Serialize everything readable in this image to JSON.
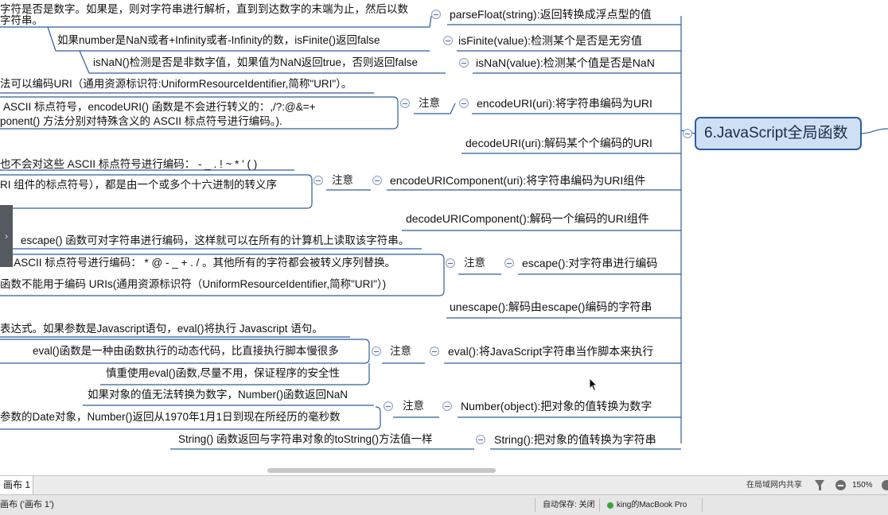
{
  "mindmap": {
    "center_topic": "6.JavaScript全局函数",
    "nodes": [
      {
        "label": "parseFloat(string):返回转换成浮点型的值",
        "notes": [
          "字符是否是数字。如果是，则对字符串进行解析，直到到达数字的末端为止，然后以数",
          "字符串。"
        ]
      },
      {
        "label": "isFinite(value):检测某个是否是无穷值",
        "notes": [
          "如果number是NaN或者+Infinity或者-Infinity的数，isFinite()返回false"
        ]
      },
      {
        "label": "isNaN(value):检测某个值是否是NaN",
        "notes": [
          "isNaN()检测是否是非数字值，如果值为NaN返回true，否则返回false"
        ]
      },
      {
        "label": "encodeURI(uri):将字符串编码为URI",
        "tag": "注意",
        "notes": [
          "法可以编码URI（通用资源标识符:UniformResourceIdentifier,简称\"URI\"）。",
          "ASCII 标点符号，encodeURI() 函数是不会进行转义的：,/?:@&=+",
          "ponent() 方法分别对特殊含义的 ASCII 标点符号进行编码。)."
        ]
      },
      {
        "label": "decodeURI(uri):解码某个个编码的URI",
        "notes": []
      },
      {
        "label": "encodeURIComponent(uri):将字符串编码为URI组件",
        "tag": "注意",
        "notes": [
          "也不会对这些 ASCII 标点符号进行编码： - _ . ! ~ * ' ( )",
          "RI 组件的标点符号），都是由一个或多个十六进制的转义序"
        ]
      },
      {
        "label": "decodeURIComponent():解码一个编码的URI组件",
        "notes": []
      },
      {
        "label": "escape():对字符串进行编码",
        "tag": "注意",
        "notes": [
          "escape() 函数可对字符串进行编码，这样就可以在所有的计算机上读取该字符串。",
          "些 ASCII 标点符号进行编码： * @ - _ + . / 。其他所有的字符都会被转义序列替换。",
          "函数不能用于编码 URIs(通用资源标识符（UniformResourceIdentifier,简称\"URI\"）)"
        ]
      },
      {
        "label": "unescape():解码由escape()编码的字符串",
        "notes": []
      },
      {
        "label": "eval():将JavaScript字符串当作脚本来执行",
        "tag": "注意",
        "notes": [
          "表达式。如果参数是Javascript语句，eval()将执行 Javascript 语句。",
          "eval()函数是一种由函数执行的动态代码，比直接执行脚本慢很多",
          "慎重使用eval()函数,尽量不用，保证程序的安全性"
        ]
      },
      {
        "label": "Number(object):把对象的值转换为数字",
        "tag": "注意",
        "notes": [
          "如果对象的值无法转换为数字，Number()函数返回NaN",
          "参数的Date对象，Number()返回从1970年1月1日到现在所经历的毫秒数"
        ]
      },
      {
        "label": "String():把对象的值转换为字符串",
        "notes": [
          "String() 函数返回与字符串对象的toString()方法值一样"
        ]
      }
    ]
  },
  "tabbar": {
    "tab_label": "画布 1",
    "share_label": "在局域网内共享",
    "zoom": "150%"
  },
  "statusbar": {
    "canvas_label": "画布 ('画布 1')",
    "autosave": "自动保存: 关闭",
    "user": "king的MacBook Pro"
  },
  "colors": {
    "link": "#2f5d9e",
    "center_fill": "#cfe0f5",
    "status_green": "#3fa33c"
  }
}
